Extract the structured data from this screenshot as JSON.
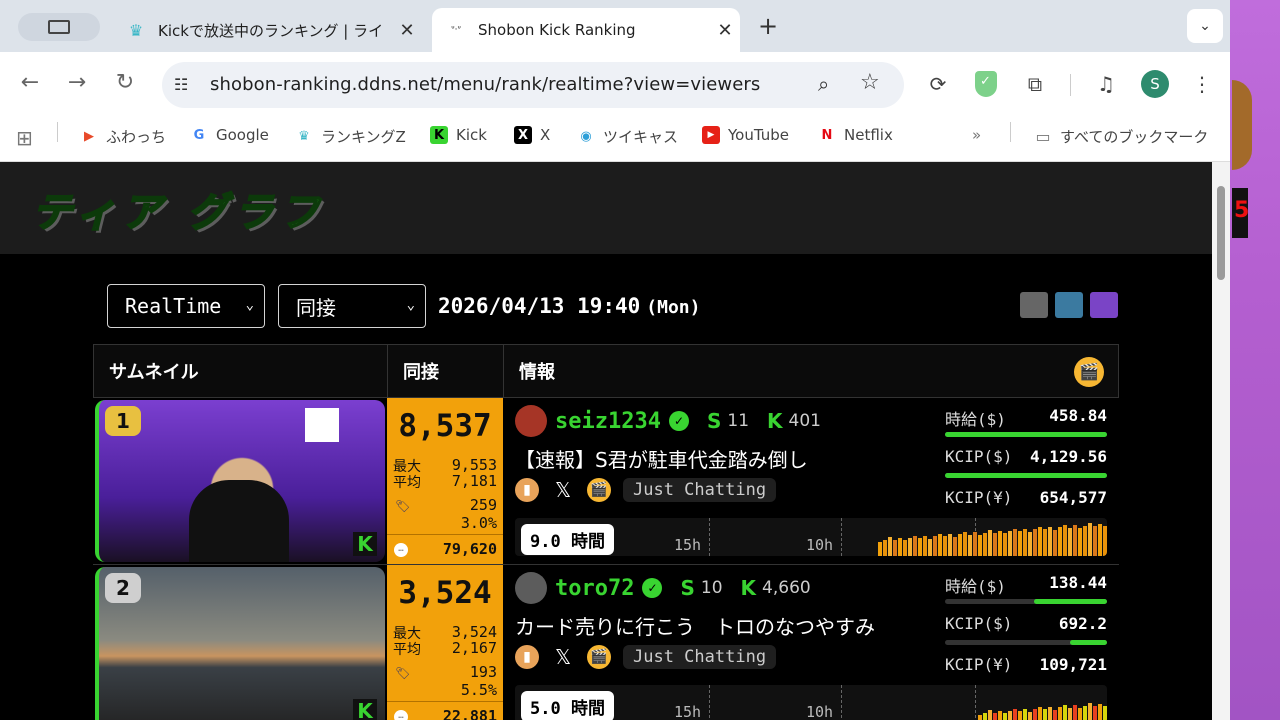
{
  "tabs": [
    {
      "title": "Kickで放送中のランキング | ライ",
      "favicon": "crown-icon",
      "active": false
    },
    {
      "title": "Shobon Kick Ranking",
      "favicon": "shobon-icon",
      "active": true
    }
  ],
  "address_bar": {
    "url": "shobon-ranking.ddns.net/menu/rank/realtime?view=viewers"
  },
  "bookmarks": [
    {
      "label": "ふわっち",
      "icon": "fuwacchi-icon"
    },
    {
      "label": "Google",
      "icon": "google-icon"
    },
    {
      "label": "ランキングZ",
      "icon": "crown-icon"
    },
    {
      "label": "Kick",
      "icon": "kick-icon"
    },
    {
      "label": "X",
      "icon": "x-icon"
    },
    {
      "label": "ツイキャス",
      "icon": "twitcasting-icon"
    },
    {
      "label": "YouTube",
      "icon": "youtube-icon"
    },
    {
      "label": "Netflix",
      "icon": "netflix-icon"
    }
  ],
  "all_bookmarks_label": "すべてのブックマーク",
  "profile_initial": "S",
  "site": {
    "logo": "ティア グラフ",
    "mode_select": "RealTime",
    "sort_select": "同接",
    "date": "2026/04/13 19:40",
    "weekday": "(Mon)"
  },
  "table": {
    "headers": [
      "サムネイル",
      "同接",
      "情報"
    ],
    "rows": [
      {
        "rank": "1",
        "viewers": "8,537",
        "max_label": "最大",
        "max": "9,553",
        "avg_label": "平均",
        "avg": "7,181",
        "tags_count": "259",
        "pct": "3.0%",
        "comments": "79,620",
        "username": "seiz1234",
        "s_count": "11",
        "k_count": "401",
        "title": "【速報】S君が駐車代金踏み倒し",
        "category": "Just Chatting",
        "hourly_label": "時給($)",
        "hourly": "458.84",
        "hourly_fill": 1.0,
        "kcip_usd_label": "KCIP($)",
        "kcip_usd": "4,129.56",
        "kcip_usd_fill": 1.0,
        "kcip_jpy_label": "KCIP(¥)",
        "kcip_jpy": "654,577",
        "hours": "9.0",
        "hours_unit": "時間",
        "tl_labels": [
          "15h",
          "10h"
        ],
        "thumb_color": "#5b2aa8",
        "rank_color": "#e8c040"
      },
      {
        "rank": "2",
        "viewers": "3,524",
        "max_label": "最大",
        "max": "3,524",
        "avg_label": "平均",
        "avg": "2,167",
        "tags_count": "193",
        "pct": "5.5%",
        "comments": "22,881",
        "username": "toro72",
        "s_count": "10",
        "k_count": "4,660",
        "title": "カード売りに行こう　トロのなつやすみ",
        "category": "Just Chatting",
        "hourly_label": "時給($)",
        "hourly": "138.44",
        "hourly_fill": 0.45,
        "kcip_usd_label": "KCIP($)",
        "kcip_usd": "692.2",
        "kcip_usd_fill": 0.23,
        "kcip_jpy_label": "KCIP(¥)",
        "kcip_jpy": "109,721",
        "hours": "5.0",
        "hours_unit": "時間",
        "tl_labels": [
          "15h",
          "10h"
        ],
        "thumb_color": "#3a4550",
        "rank_color": "#cfcfcf"
      }
    ]
  },
  "colors": {
    "accent_green": "#39d431",
    "viewer_orange": "#f2a10b"
  }
}
